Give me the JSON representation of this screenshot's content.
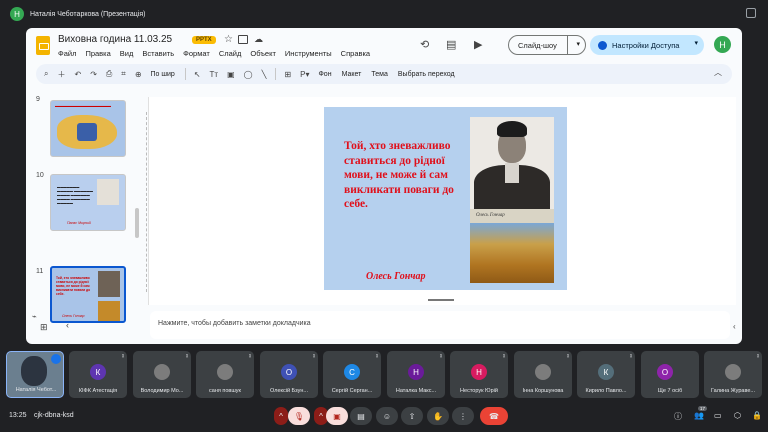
{
  "meeting": {
    "presenter_initial": "Н",
    "title": "Наталія Чеботаркова (Презентація)",
    "clock": "13:25",
    "code": "cjk-dbna-ksd",
    "participants_count": "17"
  },
  "doc": {
    "title": "Виховна година 11.03.25",
    "badge": "PPTX",
    "menus": [
      "Файл",
      "Правка",
      "Вид",
      "Вставить",
      "Формат",
      "Слайд",
      "Объект",
      "Инструменты",
      "Справка"
    ],
    "slideshow_label": "Слайд-шоу",
    "share_label": "Настройки Доступа",
    "user_initial": "Н"
  },
  "toolbar": {
    "fit_label": "По шир",
    "background_label": "Фон",
    "layout_label": "Макет",
    "theme_label": "Тема",
    "transition_label": "Выбрать переход"
  },
  "filmstrip": {
    "slide9_num": "9",
    "slide10_num": "10",
    "slide11_num": "11",
    "slide10_sig": "Панас Мирний",
    "slide11_sig": "Олесь Гончар"
  },
  "slide": {
    "quote": "Той, хто зневажливо ставиться до рідної мови, не може й сам викликати поваги до себе.",
    "author": "Олесь Гончар",
    "signature_caption": "Олесь Гончар"
  },
  "notes": {
    "placeholder": "Нажмите, чтобы добавить заметки докладчика"
  },
  "tiles": [
    {
      "name": "Наталія Чебот...",
      "initial": "",
      "color": "#6b7f8f"
    },
    {
      "name": "КІФК Атестація",
      "initial": "К",
      "color": "#5e35b1"
    },
    {
      "name": "Володимир Мо...",
      "initial": "",
      "color": "#7c7c7c"
    },
    {
      "name": "саня повшук",
      "initial": "",
      "color": "#7c7c7c"
    },
    {
      "name": "Олексій Бзун...",
      "initial": "О",
      "color": "#3f51b5"
    },
    {
      "name": "Сергій Серган...",
      "initial": "С",
      "color": "#1e88e5"
    },
    {
      "name": "Наталка Макс...",
      "initial": "Н",
      "color": "#6a1b9a"
    },
    {
      "name": "Несторук Юрій",
      "initial": "Н",
      "color": "#d81b60"
    },
    {
      "name": "Інна Коршунова",
      "initial": "",
      "color": "#7c7c7c"
    },
    {
      "name": "Кирило Павло...",
      "initial": "К",
      "color": "#546e7a"
    },
    {
      "name": "Ще 7 осіб",
      "initial": "О",
      "color": "#8e24aa"
    },
    {
      "name": "Галина Жураве...",
      "initial": "",
      "color": "#7c7c7c"
    }
  ]
}
